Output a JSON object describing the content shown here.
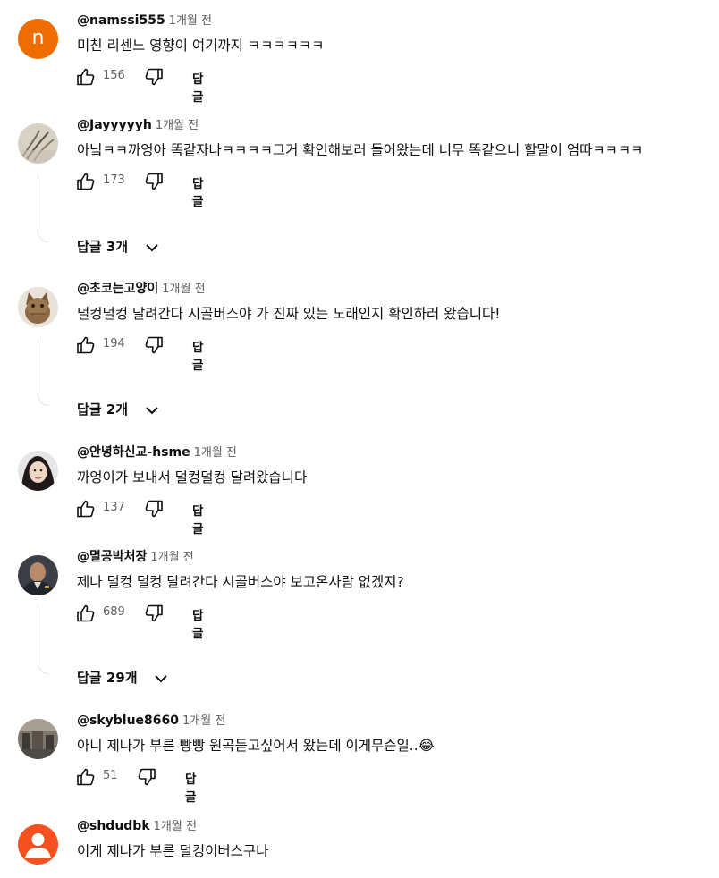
{
  "labels": {
    "reply": "답글"
  },
  "comments": [
    {
      "author": "@namssi555",
      "time": "1개월 전",
      "text": "미친 리센느 영향이 여기까지 ㅋㅋㅋㅋㅋㅋ",
      "likes": "156",
      "replies": "",
      "avatar_letter": "n",
      "avatar_color": "#ef6c00"
    },
    {
      "author": "@Jayyyyyh",
      "time": "1개월 전",
      "text": "아닠ㅋㅋ까엉아 똑같자나ㅋㅋㅋㅋ그거 확인해보러 들어왔는데 너무 똑같으니 할말이 엄따ㅋㅋㅋㅋ",
      "likes": "173",
      "replies": "답글 3개"
    },
    {
      "author": "@초코는고양이",
      "time": "1개월 전",
      "text": "덜컹덜컹 달려간다 시골버스야 가 진짜 있는 노래인지 확인하러 왔습니다!",
      "likes": "194",
      "replies": "답글 2개"
    },
    {
      "author": "@안녕하신교-hsme",
      "time": "1개월 전",
      "text": "까엉이가 보내서 덜컹덜컹 달려왔습니다",
      "likes": "137",
      "replies": ""
    },
    {
      "author": "@멸공박처장",
      "time": "1개월 전",
      "text": "제나 덜컹 덜컹 달려간다 시골버스야 보고온사람 없겠지?",
      "likes": "689",
      "replies": "답글 29개"
    },
    {
      "author": "@skyblue8660",
      "time": "1개월 전",
      "text": "아니 제나가 부른 빵빵 원곡듣고싶어서 왔는데 이게무슨일..😂",
      "likes": "51",
      "replies": ""
    },
    {
      "author": "@shdudbk",
      "time": "1개월 전",
      "text": "이게 제나가 부른 덜컹이버스구나",
      "likes": "",
      "replies": "",
      "avatar_color": "#f4511e"
    }
  ]
}
